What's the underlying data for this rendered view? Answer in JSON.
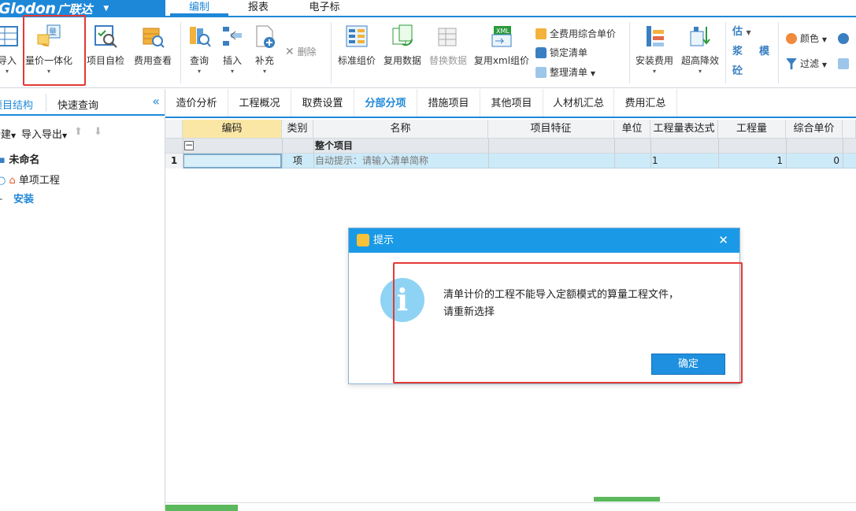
{
  "app": {
    "brand": "Glodon",
    "brand_cn": "广联达"
  },
  "menu_tabs": [
    {
      "label": "编制"
    },
    {
      "label": "报表"
    },
    {
      "label": "电子标"
    }
  ],
  "ribbon": {
    "import": "导入",
    "integrate": "量价一体化",
    "self_check": "项目自检",
    "fee_view": "费用查看",
    "query": "查询",
    "insert": "插入",
    "supplement": "补充",
    "delete": "删除",
    "std_price": "标准组价",
    "reuse_data": "复用数据",
    "replace_data": "替换数据",
    "reuse_xml": "复用xml组价",
    "all_fee_unit": "全费用综合单价",
    "lock_list": "锁定清单",
    "arrange_list": "整理清单",
    "install_fee": "安装费用",
    "high_reduce": "超高降效",
    "est": "估",
    "slurry": "浆",
    "concrete": "砼",
    "mold": "模",
    "color": "颜色",
    "filter": "过滤"
  },
  "left_panel": {
    "tabs": [
      "项目结构",
      "快速查询"
    ],
    "new_btn": "新建",
    "import_export": "导入导出",
    "tree": {
      "root": "未命名",
      "child": "单项工程",
      "leaf": "安装"
    }
  },
  "content_tabs": [
    "造价分析",
    "工程概况",
    "取费设置",
    "分部分项",
    "措施项目",
    "其他项目",
    "人材机汇总",
    "费用汇总"
  ],
  "grid": {
    "headers": [
      "编码",
      "类别",
      "名称",
      "项目特征",
      "单位",
      "工程量表达式",
      "工程量",
      "综合单价"
    ],
    "summary_row": {
      "name": "整个项目"
    },
    "rows": [
      {
        "num": "1",
        "code": "",
        "type": "项",
        "name": "自动提示：请输入清单简称",
        "expr": "1",
        "qty": "1",
        "price": "0"
      }
    ]
  },
  "dialog": {
    "title": "提示",
    "message_line1": "清单计价的工程不能导入定额模式的算量工程文件，",
    "message_line2": "请重新选择",
    "ok": "确定"
  }
}
